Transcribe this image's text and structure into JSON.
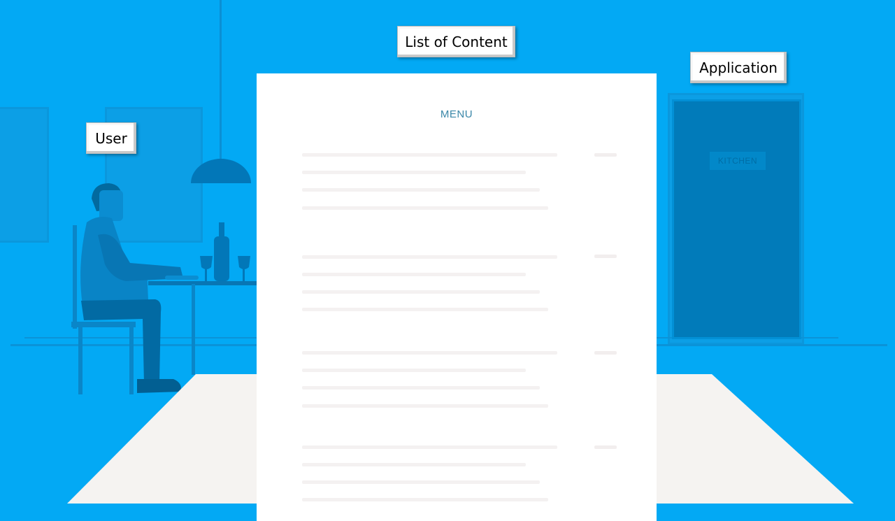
{
  "labels": {
    "list_of_content": "List of Content",
    "application": "Application",
    "user": "User"
  },
  "menu": {
    "title": "MENU"
  },
  "door": {
    "sign": "KITCHEN"
  },
  "colors": {
    "background": "#03a9f4",
    "door": "#017bba",
    "table": "#f5f3f1",
    "menu_title": "#3a87a8"
  }
}
